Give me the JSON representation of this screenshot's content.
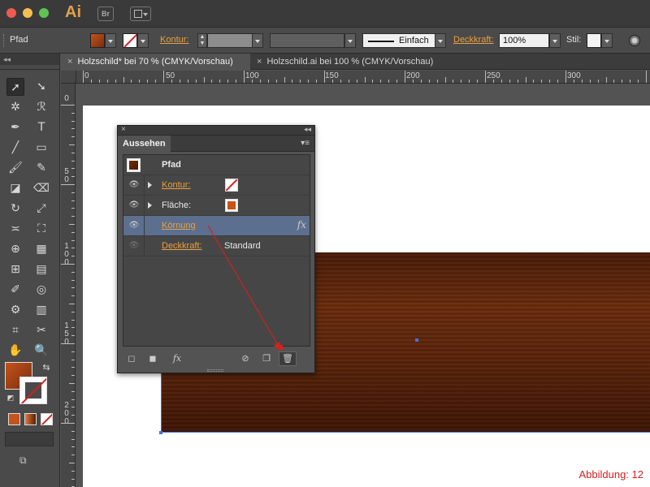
{
  "app": {
    "logo": "Ai",
    "bridge_button": "Br"
  },
  "control_bar": {
    "object_type": "Pfad",
    "stroke_label": "Kontur:",
    "stroke_style": "Einfach",
    "opacity_label": "Deckkraft:",
    "opacity_value": "100%",
    "style_label": "Stil:"
  },
  "tabs": [
    {
      "label": "Holzschild* bei 70 % (CMYK/Vorschau)",
      "active": true
    },
    {
      "label": "Holzschild.ai bei 100 % (CMYK/Vorschau)",
      "active": false
    }
  ],
  "ruler_h": [
    "0",
    "50",
    "100",
    "150",
    "200",
    "250",
    "300"
  ],
  "ruler_v": [
    "0",
    "50",
    "100",
    "150",
    "200"
  ],
  "appearance_panel": {
    "title": "Aussehen",
    "object_label": "Pfad",
    "rows": [
      {
        "label": "Kontur:",
        "type": "stroke"
      },
      {
        "label": "Fläche:",
        "type": "fill"
      },
      {
        "label": "Körnung",
        "type": "effect",
        "fx": "fx"
      },
      {
        "label": "Deckkraft:",
        "value": "Standard"
      }
    ],
    "footer_fx": "fx"
  },
  "caption": "Abbildung: 12",
  "colors": {
    "accent_orange": "#e9a03f",
    "wood": "#5a240b",
    "highlight_row": "#5c6f8f",
    "arrow": "#d42020"
  }
}
